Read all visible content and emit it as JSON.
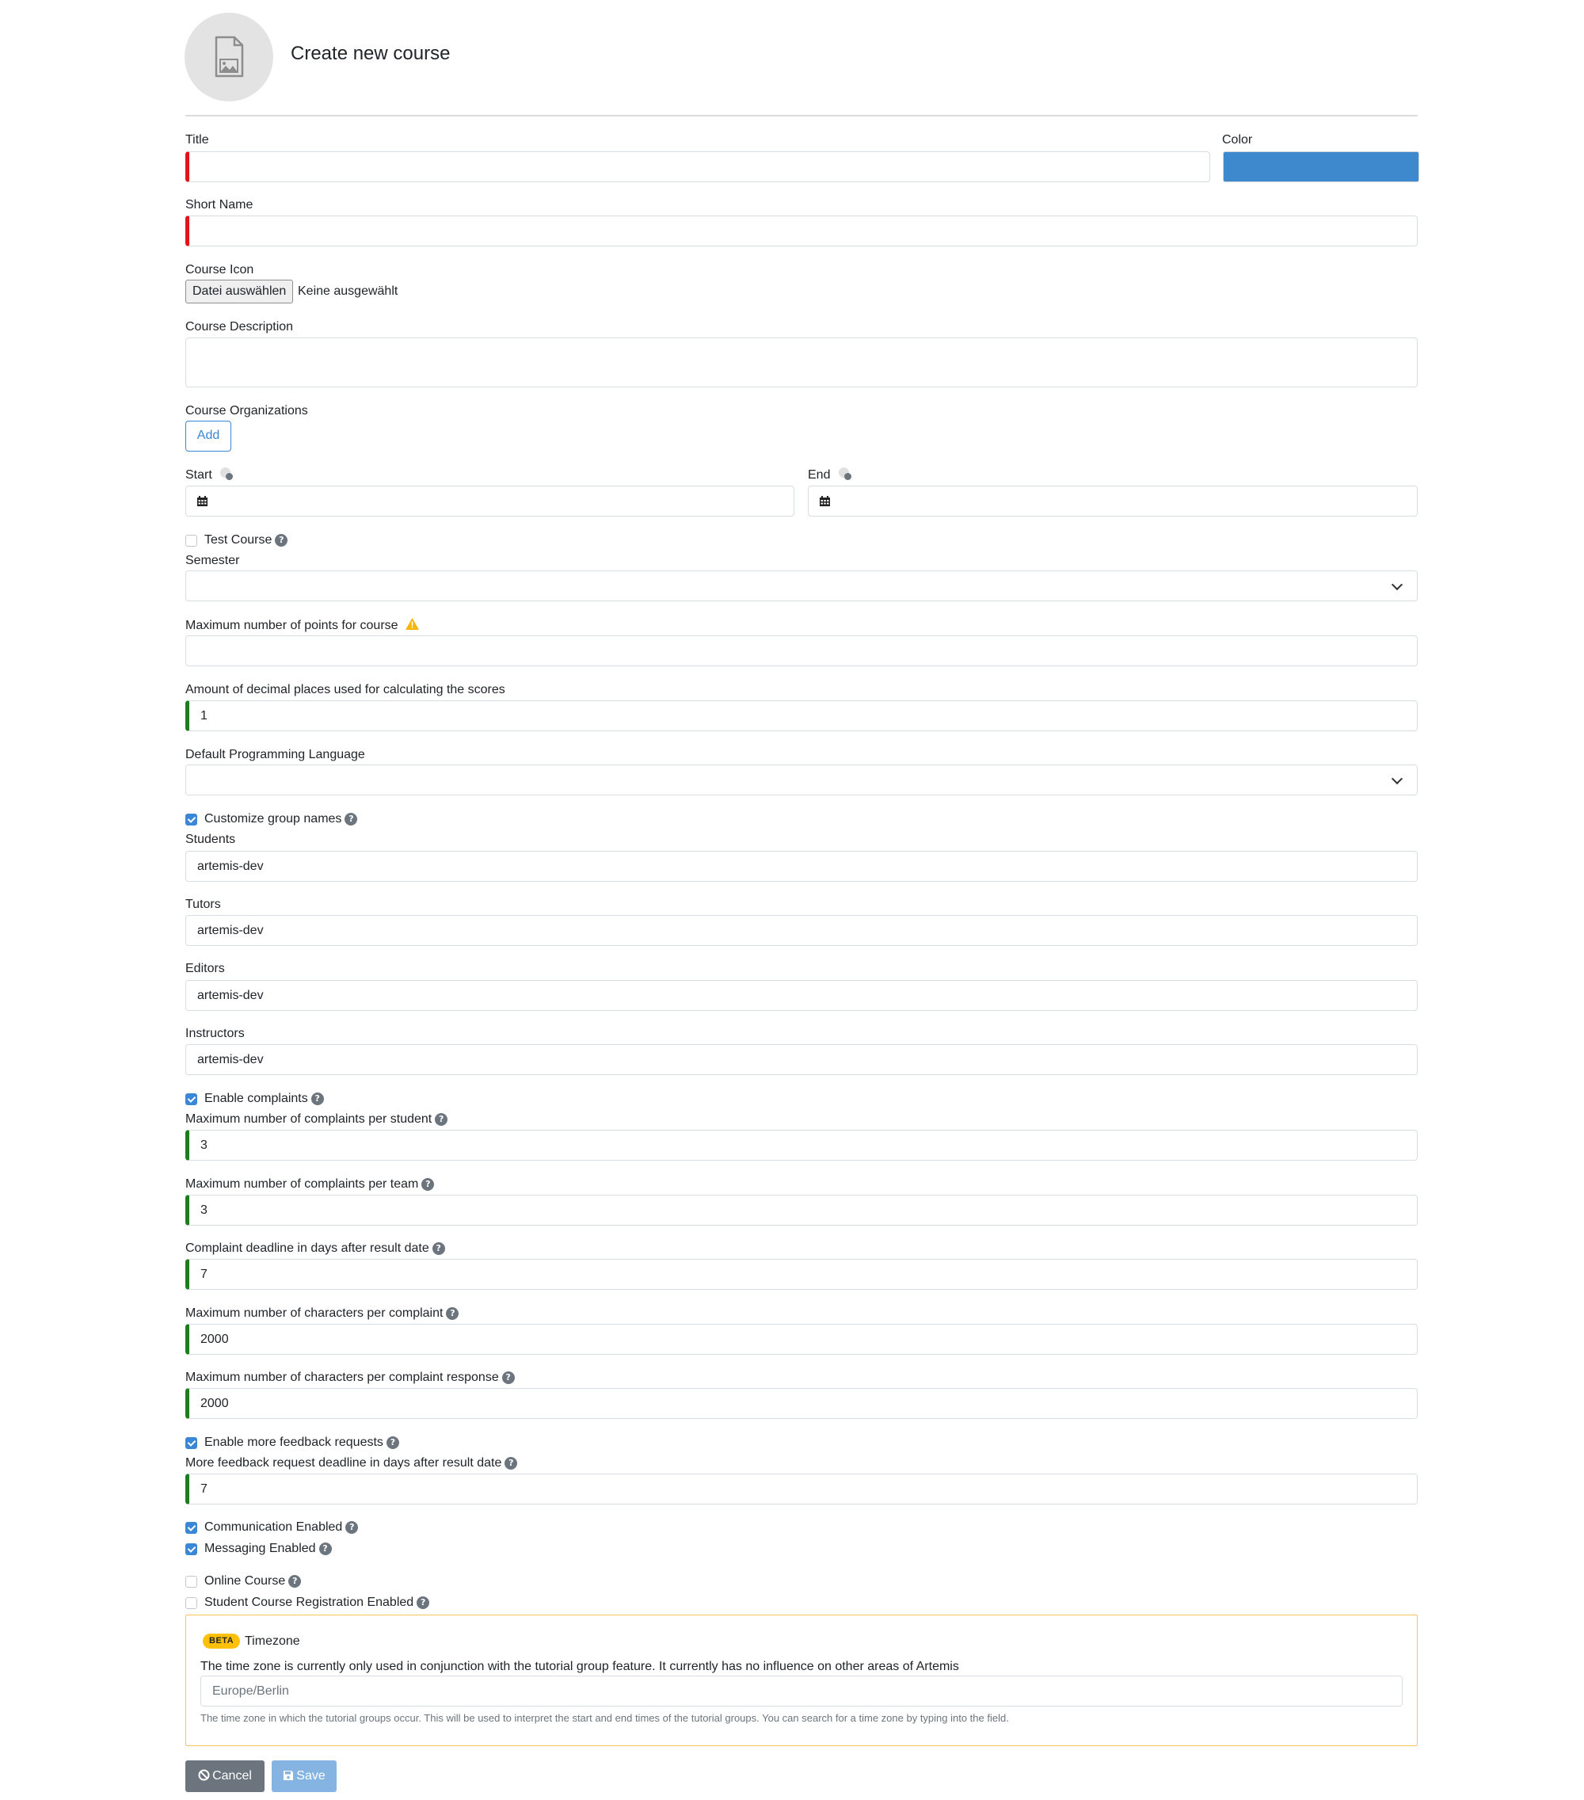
{
  "header": {
    "title": "Create new course",
    "avatar_icon": "file-image-icon"
  },
  "form": {
    "title": {
      "label": "Title",
      "value": ""
    },
    "color": {
      "label": "Color",
      "value": "#3e89cd"
    },
    "short_name": {
      "label": "Short Name",
      "value": ""
    },
    "course_icon": {
      "label": "Course Icon",
      "button": "Datei auswählen",
      "status": "Keine ausgewählt"
    },
    "description": {
      "label": "Course Description",
      "value": ""
    },
    "organizations": {
      "label": "Course Organizations",
      "add_button": "Add"
    },
    "start": {
      "label": "Start",
      "value": ""
    },
    "end": {
      "label": "End",
      "value": ""
    },
    "test_course": {
      "label": "Test Course",
      "checked": false
    },
    "semester": {
      "label": "Semester",
      "value": ""
    },
    "max_points": {
      "label": "Maximum number of points for course",
      "value": ""
    },
    "decimal_places": {
      "label": "Amount of decimal places used for calculating the scores",
      "value": "1"
    },
    "default_language": {
      "label": "Default Programming Language",
      "value": ""
    },
    "customize_groups": {
      "label": "Customize group names",
      "checked": true
    },
    "students": {
      "label": "Students",
      "value": "artemis-dev"
    },
    "tutors": {
      "label": "Tutors",
      "value": "artemis-dev"
    },
    "editors": {
      "label": "Editors",
      "value": "artemis-dev"
    },
    "instructors": {
      "label": "Instructors",
      "value": "artemis-dev"
    },
    "enable_complaints": {
      "label": "Enable complaints",
      "checked": true
    },
    "complaints_per_student": {
      "label": "Maximum number of complaints per student",
      "value": "3"
    },
    "complaints_per_team": {
      "label": "Maximum number of complaints per team",
      "value": "3"
    },
    "complaint_deadline": {
      "label": "Complaint deadline in days after result date",
      "value": "7"
    },
    "chars_per_complaint": {
      "label": "Maximum number of characters per complaint",
      "value": "2000"
    },
    "chars_per_response": {
      "label": "Maximum number of characters per complaint response",
      "value": "2000"
    },
    "enable_feedback_requests": {
      "label": "Enable more feedback requests",
      "checked": true
    },
    "feedback_deadline": {
      "label": "More feedback request deadline in days after result date",
      "value": "7"
    },
    "communication": {
      "label": "Communication Enabled",
      "checked": true
    },
    "messaging": {
      "label": "Messaging Enabled",
      "checked": true
    },
    "online_course": {
      "label": "Online Course",
      "checked": false
    },
    "registration": {
      "label": "Student Course Registration Enabled",
      "checked": false
    },
    "timezone": {
      "badge": "BETA",
      "title": "Timezone",
      "description": "The time zone is currently only used in conjunction with the tutorial group feature. It currently has no influence on other areas of Artemis",
      "value": "Europe/Berlin",
      "help": "The time zone in which the tutorial groups occur. This will be used to interpret the start and end times of the tutorial groups. You can search for a time zone by typing into the field."
    }
  },
  "actions": {
    "cancel": "Cancel",
    "save": "Save"
  },
  "colors": {
    "accent": "#3a87d6",
    "required": "#e5141a",
    "valid": "#1e7e1e",
    "beta": "#ffc107",
    "cancel_bg": "#6c757d",
    "save_bg": "#85b4e2"
  }
}
